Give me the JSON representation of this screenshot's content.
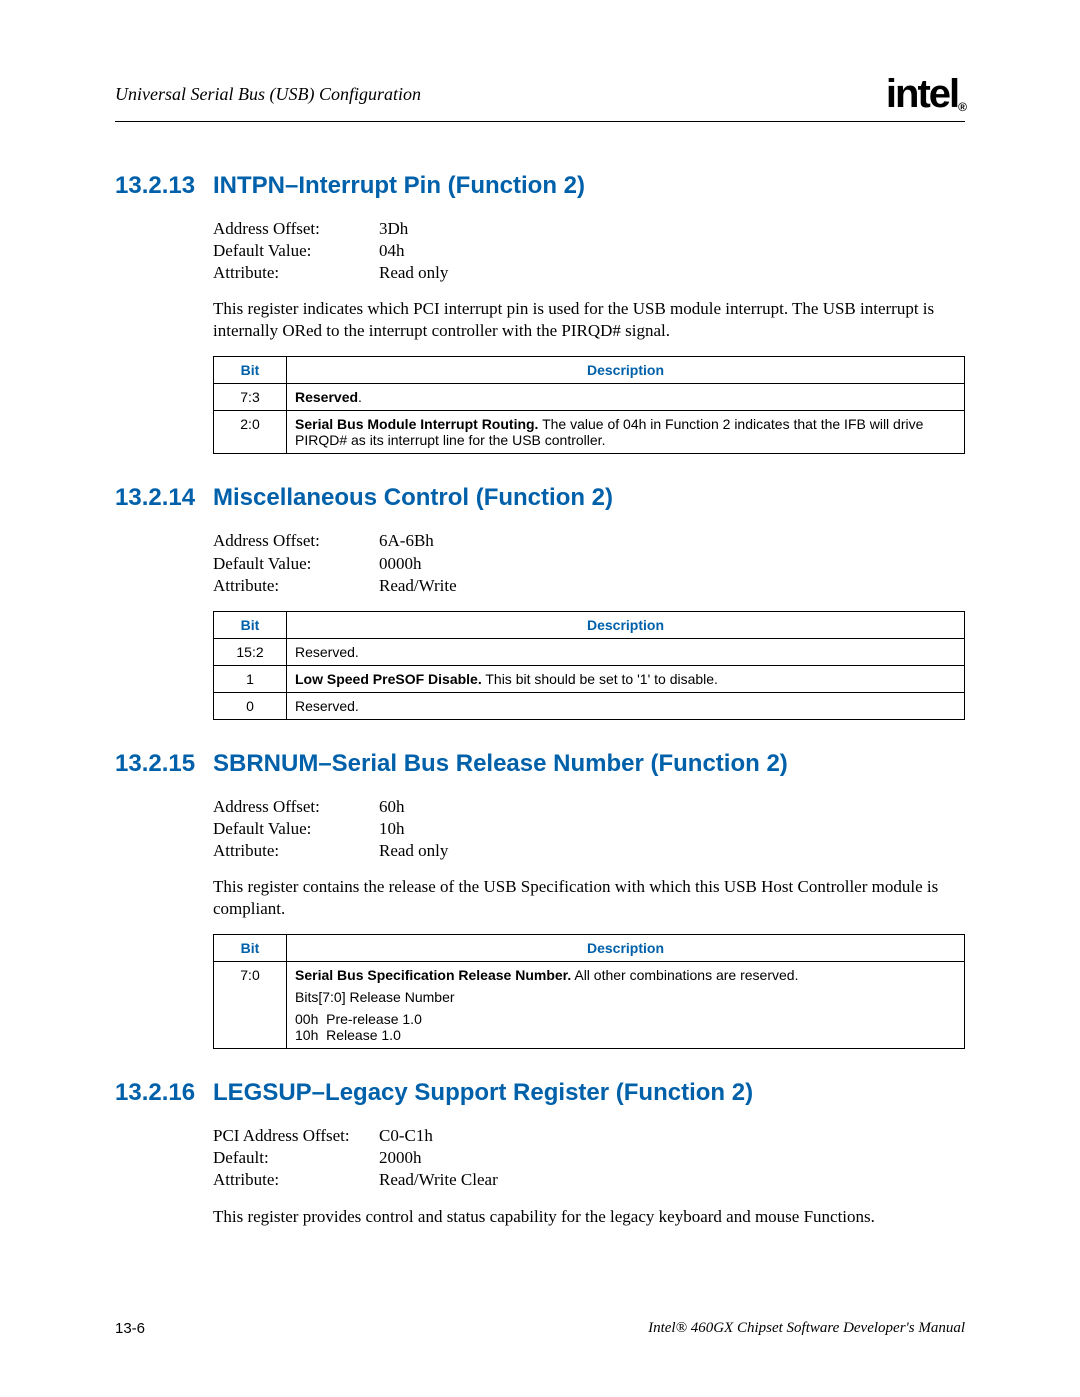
{
  "header": {
    "title": "Universal Serial Bus (USB) Configuration",
    "logo": "intel",
    "logo_sub": "®"
  },
  "sections": [
    {
      "num": "13.2.13",
      "title": "INTPN–Interrupt Pin (Function 2)",
      "reg": {
        "labels": [
          "Address Offset:",
          "Default Value:",
          "Attribute:"
        ],
        "values": [
          "3Dh",
          "04h",
          "Read only"
        ]
      },
      "para": "This register indicates which PCI interrupt pin is used for the USB module interrupt. The USB interrupt is internally ORed to the interrupt controller with the PIRQD# signal.",
      "table": {
        "head_bit": "Bit",
        "head_desc": "Description",
        "rows": [
          {
            "bit": "7:3",
            "desc_bold": "Reserved",
            "desc_rest": "."
          },
          {
            "bit": "2:0",
            "desc_bold": "Serial Bus Module Interrupt Routing.",
            "desc_rest": " The value of 04h in Function 2 indicates that the IFB will drive PIRQD# as its interrupt line for the USB controller."
          }
        ]
      }
    },
    {
      "num": "13.2.14",
      "title": "Miscellaneous Control (Function 2)",
      "reg": {
        "labels": [
          "Address Offset:",
          "Default Value:",
          "Attribute:"
        ],
        "values": [
          "6A-6Bh",
          "0000h",
          "Read/Write"
        ]
      },
      "table": {
        "head_bit": "Bit",
        "head_desc": "Description",
        "rows": [
          {
            "bit": "15:2",
            "desc_bold": "",
            "desc_rest": "Reserved."
          },
          {
            "bit": "1",
            "desc_bold": "Low Speed PreSOF Disable.",
            "desc_rest": " This bit should be set to '1' to disable."
          },
          {
            "bit": "0",
            "desc_bold": "",
            "desc_rest": "Reserved."
          }
        ]
      }
    },
    {
      "num": "13.2.15",
      "title": "SBRNUM–Serial Bus Release Number (Function 2)",
      "reg": {
        "labels": [
          "Address Offset:",
          "Default Value:",
          "Attribute:"
        ],
        "values": [
          "60h",
          "10h",
          "Read only"
        ]
      },
      "para": "This register contains the release of the USB Specification with which this USB Host Controller module is compliant.",
      "table": {
        "head_bit": "Bit",
        "head_desc": "Description",
        "rows": [
          {
            "bit": "7:0",
            "desc_bold": "Serial Bus Specification Release Number.",
            "desc_rest": " All other combinations are reserved.",
            "extra": [
              "Bits[7:0] Release Number",
              "00h  Pre-release 1.0\n10h  Release 1.0"
            ]
          }
        ]
      }
    },
    {
      "num": "13.2.16",
      "title": "LEGSUP–Legacy Support Register (Function 2)",
      "reg": {
        "labels": [
          "PCI Address Offset:",
          "Default:",
          "Attribute:"
        ],
        "values": [
          "C0-C1h",
          "2000h",
          "Read/Write Clear"
        ]
      },
      "para": "This register provides control and status capability for the legacy keyboard and mouse Functions."
    }
  ],
  "footer": {
    "left": "13-6",
    "right": "Intel® 460GX Chipset Software Developer's Manual"
  }
}
